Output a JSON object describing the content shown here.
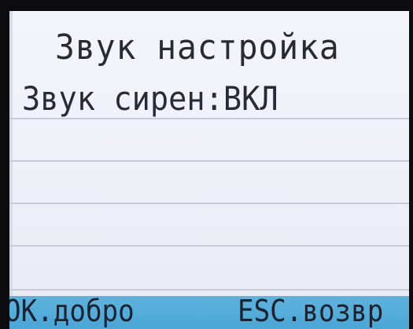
{
  "screen": {
    "title": "Звук настройка",
    "rows": [
      {
        "label": "Звук сирен:ВКЛ"
      },
      {
        "label": ""
      },
      {
        "label": ""
      },
      {
        "label": ""
      },
      {
        "label": ""
      }
    ]
  },
  "softkeys": {
    "ok": "OK.добро",
    "esc": "ESC.возвр"
  },
  "colors": {
    "screen_bg": "#f0f2f9",
    "text": "#2a2a35",
    "softbar": "#4aa6d6",
    "row_line": "#c8cbd7"
  }
}
